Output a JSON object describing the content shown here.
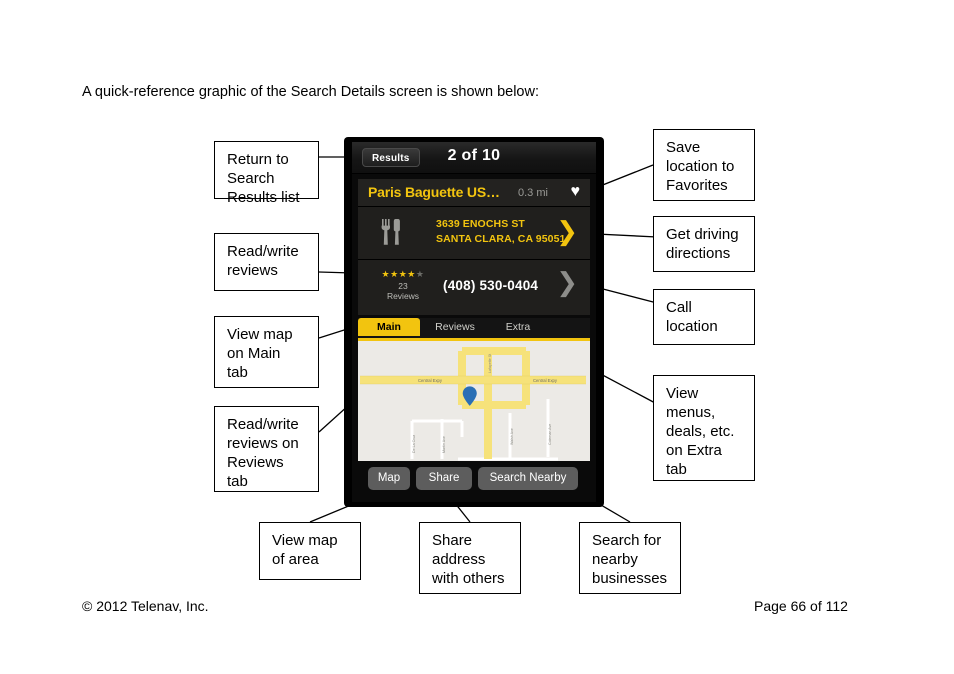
{
  "page": {
    "intro": "A quick-reference graphic of the Search Details screen is shown below:",
    "footer_left": "© 2012 Telenav, Inc.",
    "footer_right": "Page 66 of 112"
  },
  "colors": {
    "accent_yellow": "#f2c40f",
    "device_black": "#000000",
    "card_bg": "#201f1d",
    "map_bg": "#eceae6",
    "road_yellow": "#f6e27a",
    "pin_blue": "#2a6fb5",
    "button_gray": "#5d5d5d"
  },
  "phone": {
    "titlebar": {
      "back_button": "Results",
      "count_label": "2 of 10"
    },
    "detail": {
      "poi_name": "Paris Baguette US…",
      "distance": "0.3 mi",
      "favorite_icon": "heart-icon",
      "category_icon": "restaurant-fork-knife-icon",
      "address_line1": "3639 ENOCHS ST",
      "address_line2": "SANTA CLARA, CA 95051",
      "directions_icon": "chevron-right-icon",
      "call_icon": "chevron-right-icon",
      "rating_stars_filled": 4,
      "rating_stars_total": 5,
      "reviews_count": "23",
      "reviews_label": "Reviews",
      "phone_number": "(408) 530-0404"
    },
    "tabs": [
      {
        "label": "Main",
        "active": true
      },
      {
        "label": "Reviews",
        "active": false
      },
      {
        "label": "Extra",
        "active": false
      }
    ],
    "map": {
      "pin_icon": "map-pin-icon",
      "road_labels": [
        "Central Expy",
        "Central Expy"
      ],
      "street_labels": [
        "Lafayette St",
        "De La Cruz Blvd",
        "Coleman Ave"
      ]
    },
    "actions": [
      {
        "label": "Map"
      },
      {
        "label": "Share"
      },
      {
        "label": "Search Nearby"
      }
    ]
  },
  "callouts": {
    "return_to_results": [
      "Return to",
      "Search",
      "Results list"
    ],
    "read_write_reviews": [
      "Read/write",
      "reviews"
    ],
    "view_map_main": [
      "View map",
      "on Main",
      "tab"
    ],
    "reviews_tab": [
      "Read/write",
      "reviews on",
      "Reviews",
      "tab"
    ],
    "save_favorites": [
      "Save",
      "location to",
      "Favorites"
    ],
    "get_directions": [
      "Get driving",
      "directions"
    ],
    "call_location": [
      "Call",
      "location"
    ],
    "extra_tab": [
      "View",
      "menus,",
      "deals, etc.",
      "on Extra",
      "tab"
    ],
    "view_map_area": [
      "View map",
      "of area"
    ],
    "share_address": [
      "Share",
      "address",
      "with others"
    ],
    "search_nearby": [
      "Search for",
      "nearby",
      "businesses"
    ]
  }
}
